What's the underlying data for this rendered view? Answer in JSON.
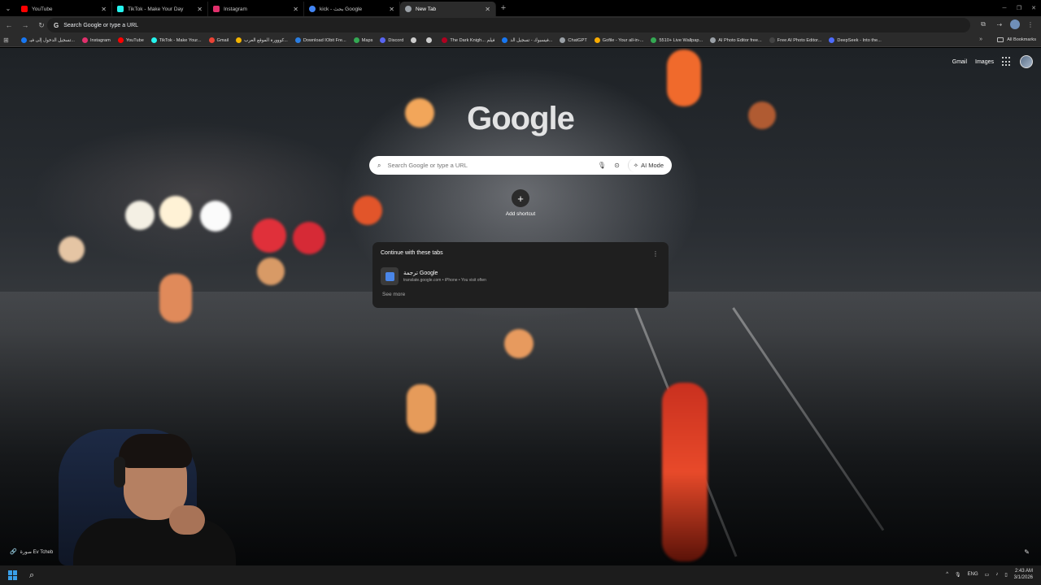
{
  "tabs": [
    {
      "label": "YouTube",
      "color": "#ff0000",
      "active": false
    },
    {
      "label": "TikTok - Make Your Day",
      "color": "#25f4ee",
      "active": false
    },
    {
      "label": "Instagram",
      "color": "#e1306c",
      "active": false
    },
    {
      "label": "kick - بحث Google",
      "color": "#4285f4",
      "active": false
    },
    {
      "label": "New Tab",
      "color": "#9aa0a6",
      "active": true
    }
  ],
  "toolbar": {
    "omnibox_placeholder": "Search Google or type a URL"
  },
  "bookmarks": [
    {
      "label": "تسجيل الدخول إلى فيـ...",
      "color": "#1877f2"
    },
    {
      "label": "Instagram",
      "color": "#e1306c"
    },
    {
      "label": "YouTube",
      "color": "#ff0000"
    },
    {
      "label": "TikTok - Make Your...",
      "color": "#25f4ee"
    },
    {
      "label": "Gmail",
      "color": "#ea4335"
    },
    {
      "label": "كووورة الموقع العرب...",
      "color": "#f4b400"
    },
    {
      "label": "Download IObit Fre...",
      "color": "#2a7de1"
    },
    {
      "label": "Maps",
      "color": "#34a853"
    },
    {
      "label": "Discord",
      "color": "#5865f2"
    },
    {
      "label": "",
      "color": "#cccccc"
    },
    {
      "label": "",
      "color": "#cccccc"
    },
    {
      "label": "The Dark Knigh... فيلم",
      "color": "#b00020"
    },
    {
      "label": "فيسبوك - تسجيل الد...",
      "color": "#1877f2"
    },
    {
      "label": "ChatGPT",
      "color": "#9aa0a6"
    },
    {
      "label": "Gofile - Your all-in-...",
      "color": "#f9ab00"
    },
    {
      "label": "5510+ Live Wallpap...",
      "color": "#34a853"
    },
    {
      "label": "AI Photo Editor free...",
      "color": "#9aa0a6"
    },
    {
      "label": "Free AI Photo Editor...",
      "color": "#444444"
    },
    {
      "label": "DeepSeek - Into the...",
      "color": "#4d6bfe"
    }
  ],
  "bookmarks_all": "All Bookmarks",
  "header_links": {
    "gmail": "Gmail",
    "images": "Images"
  },
  "logo": "Google",
  "search": {
    "placeholder": "Search Google or type a URL",
    "ai_mode": "AI Mode"
  },
  "shortcut": {
    "label": "Add shortcut"
  },
  "continue_card": {
    "title": "Continue with these tabs",
    "item_title": "ترجمة Google",
    "item_sub": "translate.google.com • iPhone • You visit often",
    "see_more": "See more"
  },
  "photo_credit": "صورة Ev Tcheb",
  "taskbar": {
    "lang": "ENG",
    "time": "2:43 AM",
    "date": "3/1/2026"
  }
}
